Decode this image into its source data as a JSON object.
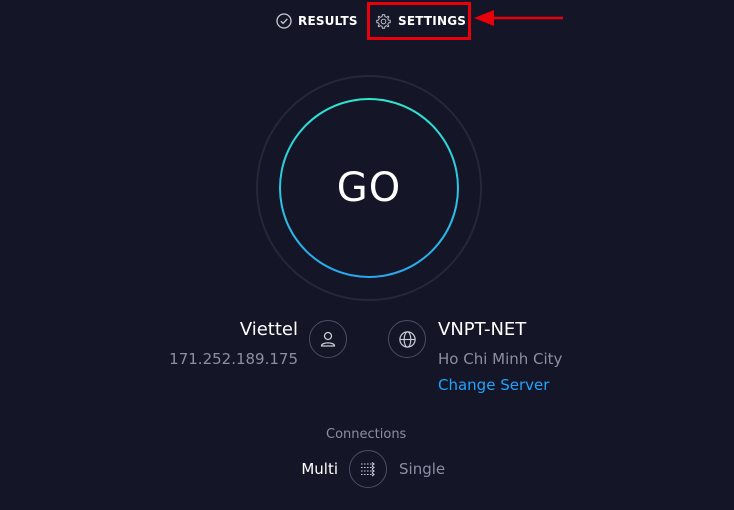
{
  "nav": {
    "results_label": "RESULTS",
    "results_icon": "check-circle-icon",
    "settings_label": "SETTINGS",
    "settings_icon": "gear-icon"
  },
  "annotation": {
    "highlight_color": "#e8000b",
    "target": "settings"
  },
  "go_button": {
    "label": "GO",
    "ring_gradient": [
      "#2ee6d1",
      "#2aa7f0"
    ]
  },
  "provider": {
    "name": "Viettel",
    "ip": "171.252.189.175",
    "icon": "user-icon"
  },
  "server": {
    "name": "VNPT-NET",
    "location": "Ho Chi Minh City",
    "change_label": "Change Server",
    "icon": "globe-icon",
    "link_color": "#1fa3ff"
  },
  "connections": {
    "label": "Connections",
    "multi_label": "Multi",
    "single_label": "Single",
    "selected": "Multi",
    "icon": "connections-toggle-icon"
  },
  "colors": {
    "background": "#141526",
    "muted_text": "#8b8fa3"
  }
}
